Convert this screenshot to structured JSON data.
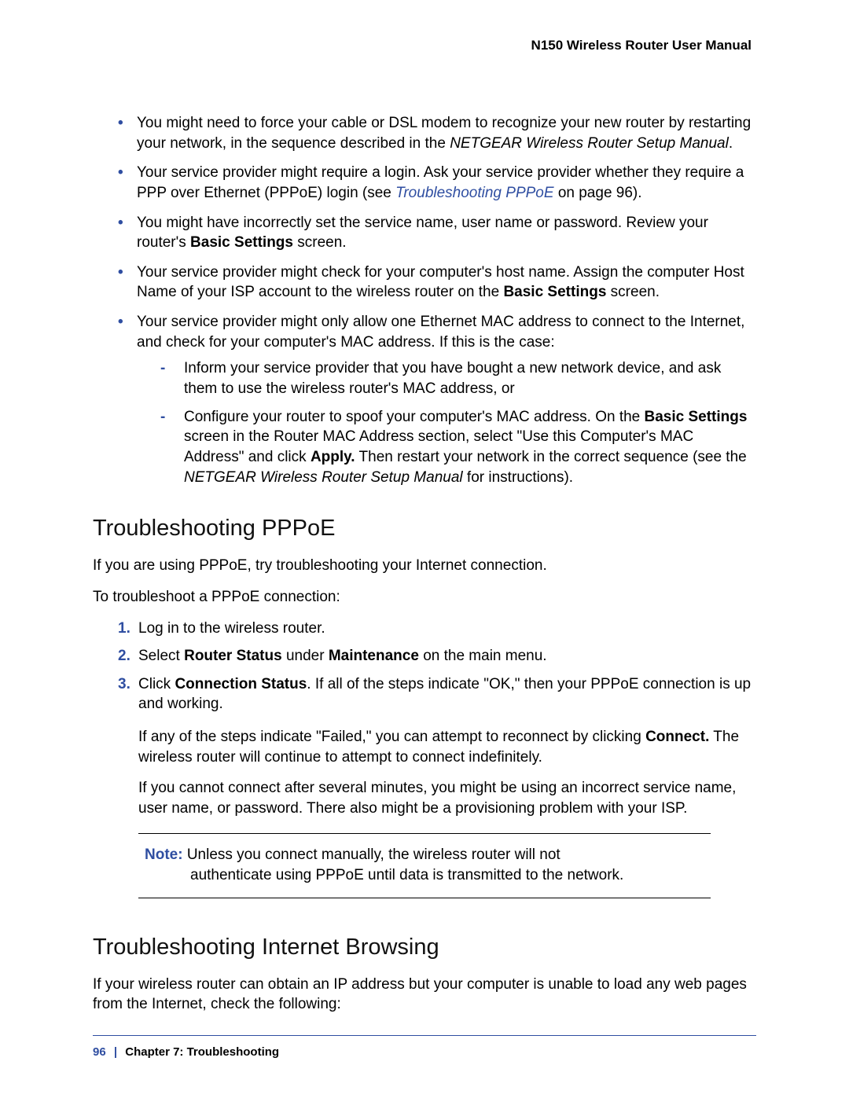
{
  "header": {
    "title": "N150 Wireless Router User Manual"
  },
  "bullets": {
    "b1_pre": "You might need to force your cable or DSL modem to recognize your new router by restarting your network, in the sequence described in the ",
    "b1_em": "NETGEAR Wireless Router Setup Manual",
    "b1_post": ".",
    "b2_pre": "Your service provider might require a login. Ask your service provider whether they require a PPP over Ethernet (PPPoE) login (see ",
    "b2_link": "Troubleshooting PPPoE",
    "b2_post": " on page 96).",
    "b3_pre": "You might have incorrectly set the service name, user name or password. Review your router's ",
    "b3_bold": "Basic Settings",
    "b3_post": " screen.",
    "b4_pre": "Your service provider might check for your computer's host name. Assign the computer Host Name of your ISP account to the wireless router on the ",
    "b4_bold": "Basic Settings",
    "b4_post": " screen.",
    "b5": "Your service provider might only allow one Ethernet MAC address to connect to the Internet, and check for your computer's MAC address. If this is the case:",
    "b5d1": "Inform your service provider that you have bought a new network device, and ask them to use the wireless router's MAC address, or",
    "b5d2_pre": "Configure your router to spoof your computer's MAC address. On the ",
    "b5d2_bold1": "Basic Settings",
    "b5d2_mid": " screen in the Router MAC Address section, select \"Use this Computer's MAC Address\" and click ",
    "b5d2_bold2": "Apply.",
    "b5d2_mid2": " Then restart your network in the correct sequence (see the ",
    "b5d2_em": "NETGEAR Wireless Router Setup Manual",
    "b5d2_post": " for instructions)."
  },
  "sec1": {
    "title": "Troubleshooting PPPoE",
    "p1": "If you are using PPPoE, try troubleshooting your Internet connection.",
    "p2": "To troubleshoot a PPPoE connection:",
    "li1": "Log in to the wireless router.",
    "li2_pre": "Select ",
    "li2_b1": "Router Status",
    "li2_mid": " under ",
    "li2_b2": "Maintenance",
    "li2_post": " on the main menu.",
    "li3_pre": "Click ",
    "li3_b": "Connection Status",
    "li3_post": ". If all of the steps indicate \"OK,\" then your PPPoE connection is up and working.",
    "p3_pre": "If any of the steps indicate \"Failed,\" you can attempt to reconnect by clicking ",
    "p3_b": "Connect.",
    "p3_post": " The wireless router will continue to attempt to connect indefinitely.",
    "p4": "If you cannot connect after several minutes, you might be using an incorrect service name, user name, or password. There also might be a provisioning problem with your ISP.",
    "note_label": "Note:  ",
    "note_line1": "Unless you connect manually, the wireless router will not",
    "note_line2": "authenticate using PPPoE until data is transmitted to the network."
  },
  "sec2": {
    "title": "Troubleshooting Internet Browsing",
    "p1": "If your wireless router can obtain an IP address but your computer is unable to load any web pages from the Internet, check the following:"
  },
  "footer": {
    "page_no": "96",
    "sep": "|",
    "chapter": "Chapter 7:  Troubleshooting"
  }
}
